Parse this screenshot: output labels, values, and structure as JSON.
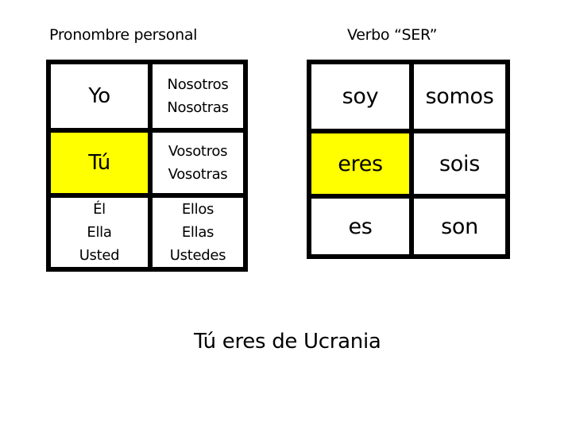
{
  "headings": {
    "pronouns": "Pronombre personal",
    "verb": "Verbo “SER”"
  },
  "highlight_color": "#ffff00",
  "pronoun_table": {
    "rows": [
      {
        "singular": [
          "Yo"
        ],
        "plural": [
          "Nosotros",
          "Nosotras"
        ],
        "highlighted": false
      },
      {
        "singular": [
          "Tú"
        ],
        "plural": [
          "Vosotros",
          "Vosotras"
        ],
        "highlighted": true
      },
      {
        "singular": [
          "Él",
          "Ella",
          "Usted"
        ],
        "plural": [
          "Ellos",
          "Ellas",
          "Ustedes"
        ],
        "highlighted": false
      }
    ]
  },
  "verb_table": {
    "rows": [
      {
        "singular": "soy",
        "plural": "somos",
        "highlighted": false
      },
      {
        "singular": "eres",
        "plural": "sois",
        "highlighted": true
      },
      {
        "singular": "es",
        "plural": "son",
        "highlighted": false
      }
    ]
  },
  "example_sentence": "Tú eres de Ucrania"
}
